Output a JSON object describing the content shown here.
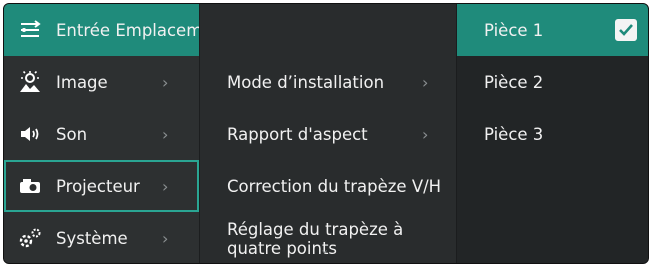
{
  "menu": {
    "items": [
      {
        "label": "Entrée Emplacement",
        "icon": "input-location-icon"
      },
      {
        "label": "Image",
        "icon": "picture-icon"
      },
      {
        "label": "Son",
        "icon": "speaker-icon"
      },
      {
        "label": "Projecteur",
        "icon": "projector-icon"
      },
      {
        "label": "Système",
        "icon": "gears-icon"
      }
    ],
    "chevron": "›"
  },
  "submenu": {
    "items": [
      {
        "label": "Mode d’installation"
      },
      {
        "label": "Rapport d'aspect"
      },
      {
        "label": "Correction du trapèze V/H"
      },
      {
        "label_line1": "Réglage du trapèze à",
        "label_line2": "quatre points"
      }
    ],
    "chevron": "›",
    "more_indicator": "⌄"
  },
  "options": {
    "items": [
      {
        "label": "Pièce 1",
        "checked": true
      },
      {
        "label": "Pièce 2",
        "checked": false
      },
      {
        "label": "Pièce 3",
        "checked": false
      }
    ]
  },
  "colors": {
    "accent": "#1f8b7b",
    "background": "#2e3132",
    "text": "#f1f1f1"
  }
}
